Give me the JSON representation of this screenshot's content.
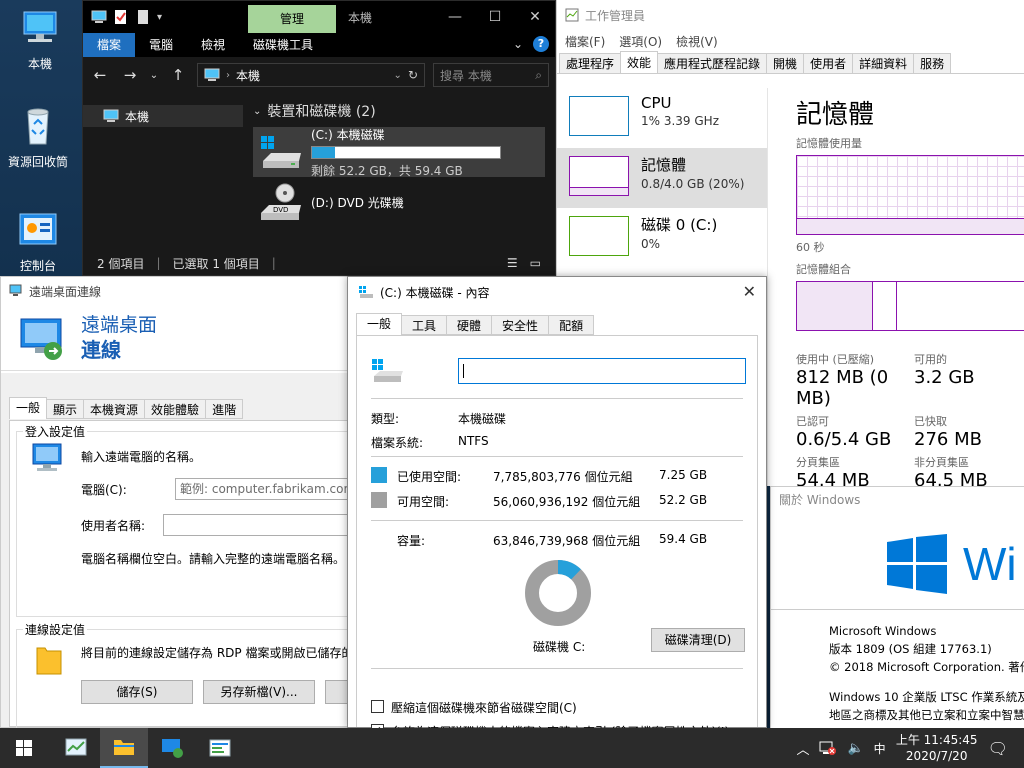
{
  "desktop": {
    "icons": [
      {
        "label": "本機"
      },
      {
        "label": "資源回收筒"
      },
      {
        "label": "控制台"
      }
    ]
  },
  "explorer": {
    "context_tab": "管理",
    "window_name": "本機",
    "ribbon_tabs": [
      "檔案",
      "電腦",
      "檢視",
      "磁碟機工具"
    ],
    "address": "本機",
    "search_placeholder": "搜尋 本機",
    "nav_item": "本機",
    "group_header": "裝置和磁碟機 (2)",
    "drive_c_name": "(C:) 本機磁碟",
    "drive_c_free": "剩餘 52.2 GB，共 59.4 GB",
    "drive_c_used_fraction": 0.122,
    "drive_d_name": "(D:) DVD 光碟機",
    "dvd_label": "DVD",
    "status_count": "2 個項目",
    "status_selected": "已選取 1 個項目"
  },
  "taskmgr": {
    "title": "工作管理員",
    "menu": [
      "檔案(F)",
      "選項(O)",
      "檢視(V)"
    ],
    "tabs": [
      "處理程序",
      "效能",
      "應用程式歷程記錄",
      "開機",
      "使用者",
      "詳細資料",
      "服務"
    ],
    "perf_items": [
      {
        "name": "CPU",
        "value": "1%  3.39 GHz"
      },
      {
        "name": "記憶體",
        "value": "0.8/4.0 GB (20%)"
      },
      {
        "name": "磁碟 0 (C:)",
        "value": "0%"
      }
    ],
    "heading": "記憶體",
    "usage_label": "記憶體使用量",
    "time_label": "60 秒",
    "composition_label": "記憶體組合",
    "stats": [
      {
        "label": "使用中 (已壓縮)",
        "value": "812 MB (0 MB)"
      },
      {
        "label": "可用的",
        "value": "3.2 GB"
      },
      {
        "label": "已認可",
        "value": "0.6/5.4 GB"
      },
      {
        "label": "已快取",
        "value": "276 MB"
      },
      {
        "label": "分頁集區",
        "value": "54.4 MB"
      },
      {
        "label": "非分頁集區",
        "value": "64.5 MB"
      }
    ],
    "colors": {
      "cpu": "#117dbb",
      "memory": "#8b12ae",
      "disk": "#4da60c"
    }
  },
  "about": {
    "title": "關於 Windows",
    "logo_text": "Wi",
    "lines": [
      "Microsoft Windows",
      "版本 1809 (OS 組建 17763.1)",
      "© 2018 Microsoft Corporation. 著作",
      "",
      "Windows 10 企業版 LTSC 作業系統及",
      "地區之商標及其他已立案和立案中智慧"
    ]
  },
  "rdp": {
    "title": "遠端桌面連線",
    "banner_line1": "遠端桌面",
    "banner_line2": "連線",
    "tabs": [
      "一般",
      "顯示",
      "本機資源",
      "效能體驗",
      "進階"
    ],
    "login_group": "登入設定值",
    "prompt": "輸入遠端電腦的名稱。",
    "computer_label": "電腦(C):",
    "computer_placeholder": "範例: computer.fabrikam.com",
    "user_label": "使用者名稱:",
    "user_value": "",
    "empty_note": "電腦名稱欄位空白。請輸入完整的遠端電腦名稱。",
    "conn_group": "連線設定值",
    "conn_desc": "將目前的連線設定儲存為 RDP 檔案或開啟已儲存的",
    "save_btn": "儲存(S)",
    "saveas_btn": "另存新檔(V)..."
  },
  "props": {
    "title": "(C:) 本機磁碟 - 內容",
    "tabs": [
      "一般",
      "工具",
      "硬體",
      "安全性",
      "配額"
    ],
    "name_value": "",
    "type_label": "類型:",
    "type_value": "本機磁碟",
    "fs_label": "檔案系統:",
    "fs_value": "NTFS",
    "used_label": "已使用空間:",
    "used_bytes": "7,785,803,776 個位元組",
    "used_gb": "7.25 GB",
    "free_label": "可用空間:",
    "free_bytes": "56,060,936,192 個位元組",
    "free_gb": "52.2 GB",
    "cap_label": "容量:",
    "cap_bytes": "63,846,739,968 個位元組",
    "cap_gb": "59.4 GB",
    "drive_label": "磁碟機 C:",
    "cleanup_btn": "磁碟清理(D)",
    "compress_label": "壓縮這個磁碟機來節省磁碟空間(C)",
    "compress_checked": false,
    "index_label": "允許為這個磁碟機中的檔案內容建立索引 (除了檔案屬性之外)(I)",
    "index_checked": true,
    "used_color": "#26a0da",
    "free_color": "#a0a0a0",
    "used_fraction": 0.122
  },
  "taskbar": {
    "ime": "中",
    "time": "上午 11:45:45",
    "date": "2020/7/20"
  }
}
